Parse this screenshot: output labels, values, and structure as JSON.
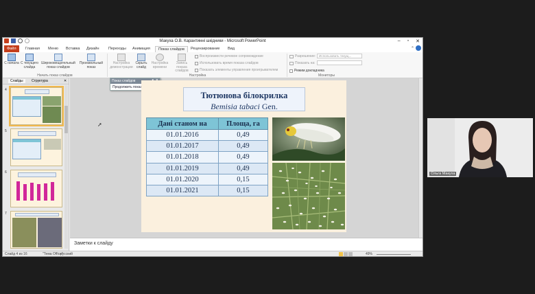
{
  "window": {
    "title": "Макуха О.В. Карантинні шкідники - Microsoft PowerPoint"
  },
  "ribbon_tabs": [
    {
      "label": "Файл",
      "active": false
    },
    {
      "label": "Главная",
      "active": false
    },
    {
      "label": "Меню",
      "active": false
    },
    {
      "label": "Вставка",
      "active": false
    },
    {
      "label": "Дизайн",
      "active": false
    },
    {
      "label": "Переходы",
      "active": false
    },
    {
      "label": "Анимация",
      "active": false
    },
    {
      "label": "Показ слайдов",
      "active": true
    },
    {
      "label": "Рецензирование",
      "active": false
    },
    {
      "label": "Вид",
      "active": false
    }
  ],
  "ribbon": {
    "from_start": "С начала",
    "from_current": "С текущего слайда",
    "broadcast": "Широковещательный показ слайдов",
    "custom_show": "Произвольный показ",
    "group_start": "Начать показ слайдов",
    "setup": "Настройка демонстрации",
    "hide_slide": "Скрыть слайд",
    "rehearse": "Настройка времени",
    "record": "Запись показа слайдов",
    "group_setup": "Настройка",
    "chk_narration": "Воспроизвести речевое сопровождение",
    "chk_timings": "Использовать время показа слайдов",
    "chk_controls": "Показать элементы управления проигрывателем",
    "resolution_label": "Разрешение:",
    "resolution_value": "Использовать текущ...",
    "show_on_label": "Показать на:",
    "presenter_view": "Режим докладчика",
    "group_monitors": "Мониторы"
  },
  "slides_panel": {
    "tab_slides": "Слайды",
    "tab_outline": "Структура",
    "thumb_numbers": [
      "4",
      "5",
      "6",
      "7"
    ]
  },
  "popup": {
    "title": "Показ слайдов",
    "item": "Продолжить показ слайдов"
  },
  "slide": {
    "title_line1": "Тютюнова білокрилка",
    "title_line2_italic": "Bemisia tabaci",
    "title_line2_rest": " Gen.",
    "table": {
      "headers": [
        "Дані станом на",
        "Площа, га"
      ],
      "rows": [
        [
          "01.01.2016",
          "0,49"
        ],
        [
          "01.01.2017",
          "0,49"
        ],
        [
          "01.01.2018",
          "0,49"
        ],
        [
          "01.01.2019",
          "0,49"
        ],
        [
          "01.01.2020",
          "0,15"
        ],
        [
          "01.01.2021",
          "0,15"
        ]
      ]
    }
  },
  "notes": {
    "placeholder": "Заметки к слайду"
  },
  "statusbar": {
    "slide_counter": "Слайд 4 из 16",
    "theme": "\"Тема Office\"",
    "language": "русский",
    "zoom": "49%"
  },
  "webcam": {
    "name": "Ольга Макуха"
  },
  "colors": {
    "file_tab": "#c43e1c",
    "slide_bg": "#fbf0de",
    "table_header": "#7ec4d6"
  }
}
